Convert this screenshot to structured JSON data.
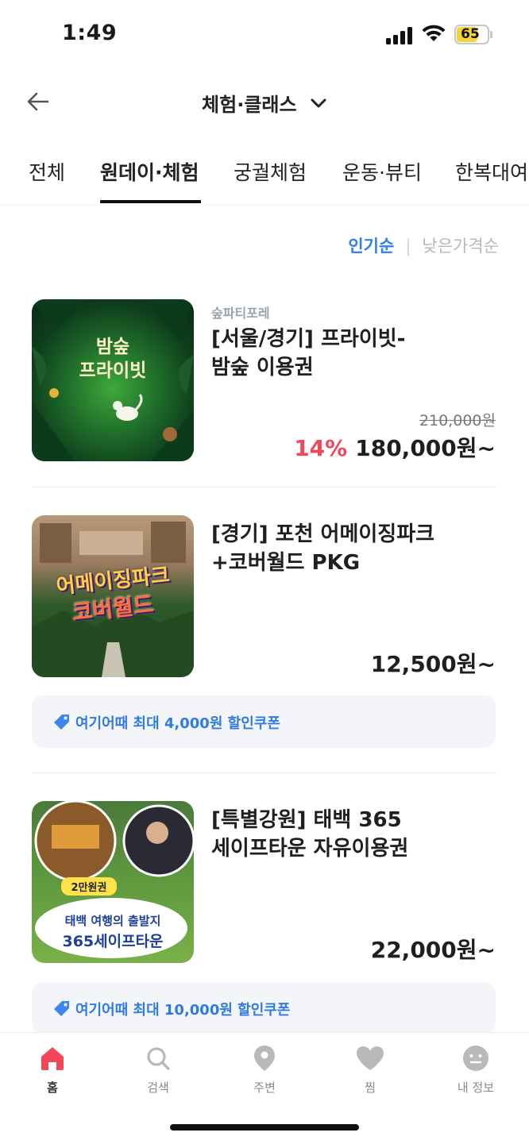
{
  "status_bar": {
    "time": "1:49",
    "battery": "65"
  },
  "header": {
    "title": "체험·클래스"
  },
  "tabs": [
    {
      "label": "전체"
    },
    {
      "label": "원데이·체험",
      "active": true
    },
    {
      "label": "궁궐체험"
    },
    {
      "label": "운동·뷰티"
    },
    {
      "label": "한복대여"
    }
  ],
  "sort": {
    "popular": "인기순",
    "low_price": "낮은가격순"
  },
  "products": [
    {
      "seller": "숲파티포레",
      "title_line1": "[서울/경기] 프라이빗-",
      "title_line2": "밤숲 이용권",
      "original_price": "210,000원",
      "discount": "14%",
      "price": "180,000원~",
      "thumb_text_1": "밤숲",
      "thumb_text_2": "프라이빗"
    },
    {
      "title_line1": "[경기] 포천 어메이징파크",
      "title_line2": "+코버월드 PKG",
      "price": "12,500원~",
      "coupon": "여기어때 최대 4,000원 할인쿠폰",
      "thumb_text_1": "어메이징파크",
      "thumb_text_2": "코버월드"
    },
    {
      "title_line1": "[특별강원] 태백 365",
      "title_line2": "세이프타운 자유이용권",
      "price": "22,000원~",
      "coupon": "여기어때 최대 10,000원 할인쿠폰",
      "thumb_badge": "2만원권",
      "thumb_text_1": "태백 여행의 출발지",
      "thumb_text_2": "365세이프타운"
    }
  ],
  "bottom_nav": [
    {
      "label": "홈",
      "icon": "home-icon",
      "active": true
    },
    {
      "label": "검색",
      "icon": "search-icon"
    },
    {
      "label": "주변",
      "icon": "location-pin-icon"
    },
    {
      "label": "찜",
      "icon": "heart-icon"
    },
    {
      "label": "내 정보",
      "icon": "profile-face-icon"
    }
  ],
  "colors": {
    "accent_blue": "#2f80ed",
    "discount_red": "#f0475a",
    "home_active": "#f0475a"
  }
}
